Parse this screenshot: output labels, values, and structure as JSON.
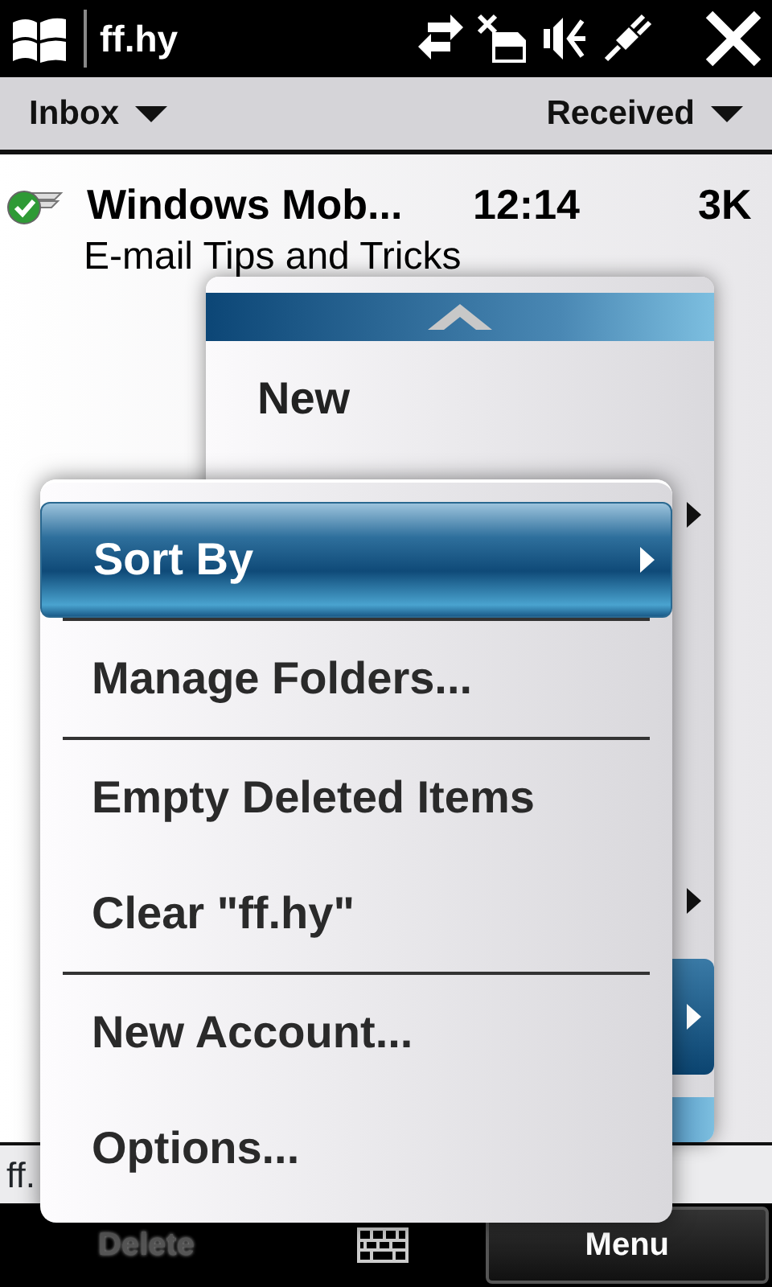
{
  "title_bar": {
    "title": "ff.hy"
  },
  "filter_bar": {
    "folder": "Inbox",
    "sort": "Received"
  },
  "messages": [
    {
      "sender": "Windows Mob...",
      "time": "12:14",
      "size": "3K",
      "subject": "E-mail Tips and Tricks"
    }
  ],
  "status_line": "ff.",
  "back_menu": {
    "rows": [
      {
        "label": "New",
        "submenu": false,
        "selected": false
      },
      {
        "submenu": true,
        "selected": false
      },
      {
        "submenu": true,
        "selected": false
      },
      {
        "submenu": true,
        "selected": true
      }
    ]
  },
  "menu": {
    "items": [
      {
        "label": "Sort By",
        "selected": true,
        "submenu": true,
        "divider_after": true
      },
      {
        "label": "Manage Folders...",
        "selected": false,
        "submenu": false,
        "divider_after": true
      },
      {
        "label": "Empty Deleted Items",
        "selected": false,
        "submenu": false,
        "divider_after": false
      },
      {
        "label": "Clear \"ff.hy\"",
        "selected": false,
        "submenu": false,
        "divider_after": true
      },
      {
        "label": "New Account...",
        "selected": false,
        "submenu": false,
        "divider_after": false
      },
      {
        "label": "Options...",
        "selected": false,
        "submenu": false,
        "divider_after": false
      }
    ]
  },
  "softkeys": {
    "left": {
      "label": "Delete",
      "disabled": true
    },
    "right": {
      "label": "Menu",
      "pressed": true
    }
  }
}
